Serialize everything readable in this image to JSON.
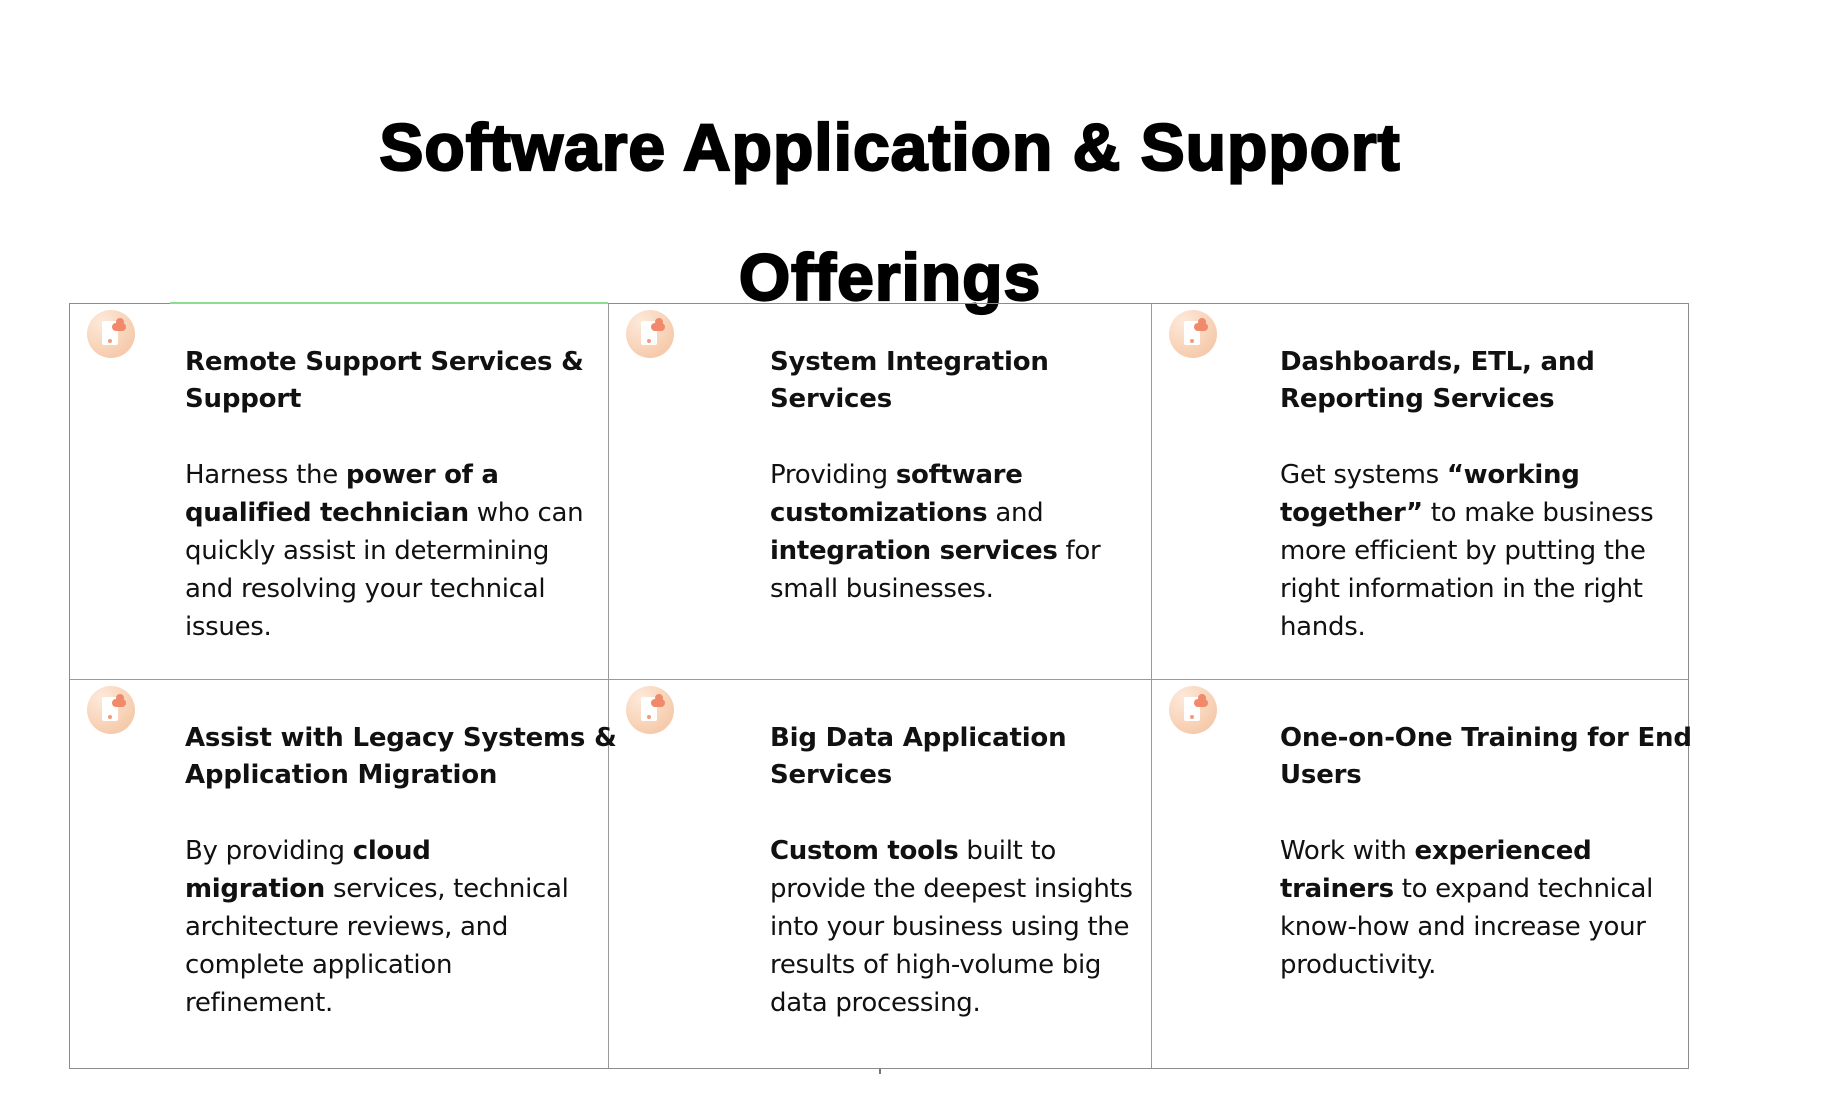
{
  "page": {
    "title_lines": [
      "Software Application & Support",
      "Offerings"
    ]
  },
  "theme": {
    "icon_circle": "#f8d3b8",
    "icon_cloud": "#f08a6a",
    "grid_border": "#8c8c8c",
    "accent_line": "#8edc94"
  },
  "offerings": [
    {
      "icon": "mobile-cloud-icon",
      "heading_lines": [
        "Remote Support Services &",
        "Support"
      ],
      "body_lines": [
        [
          {
            "t": "Harness the ",
            "b": false
          },
          {
            "t": "power of a",
            "b": true
          }
        ],
        [
          {
            "t": "qualified technician",
            "b": true
          },
          {
            "t": " who can",
            "b": false
          }
        ],
        [
          {
            "t": "quickly assist in determining",
            "b": false
          }
        ],
        [
          {
            "t": "and resolving your technical",
            "b": false
          }
        ],
        [
          {
            "t": "issues.",
            "b": false
          }
        ]
      ]
    },
    {
      "icon": "mobile-cloud-icon",
      "heading_lines": [
        "System Integration",
        "Services"
      ],
      "body_lines": [
        [
          {
            "t": "Providing ",
            "b": false
          },
          {
            "t": "software",
            "b": true
          }
        ],
        [
          {
            "t": "customizations",
            "b": true
          },
          {
            "t": " and",
            "b": false
          }
        ],
        [
          {
            "t": "integration services",
            "b": true
          },
          {
            "t": " for",
            "b": false
          }
        ],
        [
          {
            "t": "small businesses.",
            "b": false
          }
        ]
      ]
    },
    {
      "icon": "mobile-cloud-icon",
      "heading_lines": [
        "Dashboards, ETL, and",
        "Reporting Services"
      ],
      "body_lines": [
        [
          {
            "t": "Get systems ",
            "b": false
          },
          {
            "t": "“working",
            "b": true
          }
        ],
        [
          {
            "t": "together”",
            "b": true
          },
          {
            "t": " to make business",
            "b": false
          }
        ],
        [
          {
            "t": "more efficient by putting the",
            "b": false
          }
        ],
        [
          {
            "t": "right information in the right",
            "b": false
          }
        ],
        [
          {
            "t": "hands.",
            "b": false
          }
        ]
      ]
    },
    {
      "icon": "mobile-cloud-icon",
      "heading_lines": [
        "Assist with Legacy Systems &",
        "Application Migration"
      ],
      "body_lines": [
        [
          {
            "t": "By providing ",
            "b": false
          },
          {
            "t": "cloud",
            "b": true
          }
        ],
        [
          {
            "t": "migration",
            "b": true
          },
          {
            "t": " services, technical",
            "b": false
          }
        ],
        [
          {
            "t": "architecture reviews, and",
            "b": false
          }
        ],
        [
          {
            "t": "complete application",
            "b": false
          }
        ],
        [
          {
            "t": "refinement.",
            "b": false
          }
        ]
      ]
    },
    {
      "icon": "mobile-cloud-icon",
      "heading_lines": [
        "Big Data Application",
        "Services"
      ],
      "body_lines": [
        [
          {
            "t": "Custom tools",
            "b": true
          },
          {
            "t": " built to",
            "b": false
          }
        ],
        [
          {
            "t": "provide the deepest insights",
            "b": false
          }
        ],
        [
          {
            "t": "into your business using the",
            "b": false
          }
        ],
        [
          {
            "t": "results of high-volume big",
            "b": false
          }
        ],
        [
          {
            "t": "data processing.",
            "b": false
          }
        ]
      ]
    },
    {
      "icon": "mobile-cloud-icon",
      "heading_lines": [
        "One-on-One Training for End",
        "Users"
      ],
      "body_lines": [
        [
          {
            "t": "Work with ",
            "b": false
          },
          {
            "t": "experienced",
            "b": true
          }
        ],
        [
          {
            "t": "trainers",
            "b": true
          },
          {
            "t": " to expand technical",
            "b": false
          }
        ],
        [
          {
            "t": "know-how and increase your",
            "b": false
          }
        ],
        [
          {
            "t": "productivity.",
            "b": false
          }
        ]
      ]
    }
  ]
}
